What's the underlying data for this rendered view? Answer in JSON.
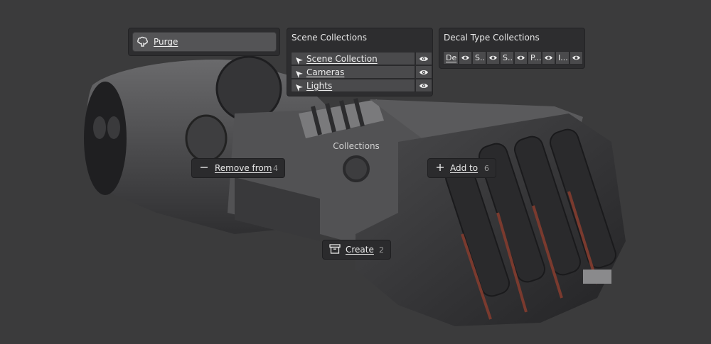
{
  "purge_menu": {
    "purge_label": "Purge",
    "icon": "brain-icon"
  },
  "scene_collections": {
    "title": "Scene Collections",
    "items": [
      {
        "label": "Scene Collection",
        "icon": "cursor-arrow-icon",
        "visibility_icon": "eye-icon"
      },
      {
        "label": "Cameras",
        "icon": "cursor-arrow-icon",
        "visibility_icon": "eye-icon"
      },
      {
        "label": "Lights",
        "icon": "cursor-arrow-icon",
        "visibility_icon": "eye-icon"
      }
    ]
  },
  "decal_type_collections": {
    "title": "Decal Type Collections",
    "items": [
      "De",
      "S...",
      "S...",
      "P...",
      "I..."
    ],
    "visibility_icon": "eye-icon"
  },
  "pie_menu": {
    "title": "Collections",
    "remove": {
      "label": "Remove from",
      "hotkey": "4",
      "icon": "minus-icon"
    },
    "add": {
      "label": "Add to",
      "hotkey": "6",
      "icon": "plus-icon"
    },
    "create": {
      "label": "Create",
      "hotkey": "2",
      "icon": "archive-box-icon"
    }
  },
  "colors": {
    "background": "#3b3b3c",
    "panel": "#2d2d2f",
    "row": "#4a4a4c",
    "accent_orange": "#c8553a"
  }
}
